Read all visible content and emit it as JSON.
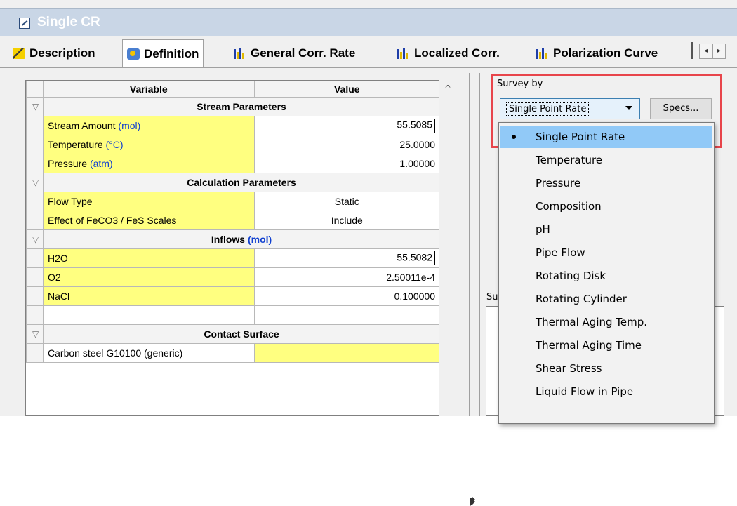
{
  "window": {
    "title": "Single CR"
  },
  "tabs": [
    {
      "label": "Description"
    },
    {
      "label": "Definition"
    },
    {
      "label": "General Corr. Rate"
    },
    {
      "label": "Localized Corr."
    },
    {
      "label": "Polarization Curve"
    }
  ],
  "grid": {
    "headers": {
      "variable": "Variable",
      "value": "Value"
    },
    "sections": {
      "stream": "Stream Parameters",
      "calc": "Calculation Parameters",
      "inflows": "Inflows",
      "inflows_unit": "(mol)",
      "contact": "Contact Surface"
    },
    "rows": {
      "stream_amount": {
        "label": "Stream Amount",
        "unit": "(mol)",
        "value": "55.5085"
      },
      "temperature": {
        "label": "Temperature",
        "unit": "(°C)",
        "value": "25.0000"
      },
      "pressure": {
        "label": "Pressure",
        "unit": "(atm)",
        "value": "1.00000"
      },
      "flow_type": {
        "label": "Flow Type",
        "value": "Static"
      },
      "scales": {
        "label": "Effect of FeCO3 / FeS Scales",
        "value": "Include"
      },
      "h2o": {
        "label": "H2O",
        "value": "55.5082"
      },
      "o2": {
        "label": "O2",
        "value": "2.50011e-4"
      },
      "nacl": {
        "label": "NaCl",
        "value": "0.100000"
      },
      "contact_surface": {
        "label": "Carbon steel G10100 (generic)",
        "value": ""
      }
    }
  },
  "survey": {
    "label": "Survey by",
    "selected": "Single Point Rate",
    "specs_label": "Specs...",
    "options": [
      "Single Point Rate",
      "Temperature",
      "Pressure",
      "Composition",
      "pH",
      "Pipe Flow",
      "Rotating Disk",
      "Rotating Cylinder",
      "Thermal Aging Temp.",
      "Thermal Aging Time",
      "Shear Stress",
      "Liquid Flow in Pipe"
    ]
  },
  "lower_panel": {
    "label_peek": "Su"
  },
  "colors": {
    "highlight": "#e8454b",
    "selection": "#91c9f7",
    "input_cell": "#ffff80",
    "unit_text": "#1040d0"
  }
}
